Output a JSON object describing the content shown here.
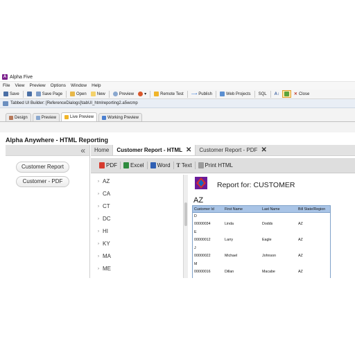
{
  "window": {
    "title": "Alpha Five",
    "icon": "alpha-five-app-icon"
  },
  "menu": [
    "File",
    "View",
    "Preview",
    "Options",
    "Window",
    "Help"
  ],
  "toolbar": {
    "save": "Save",
    "save_page": "Save Page",
    "open": "Open",
    "new": "New",
    "preview": "Preview",
    "remote_test": "Remote Test",
    "publish": "Publish",
    "web_projects": "Web Projects",
    "sql": "SQL",
    "close": "Close"
  },
  "document": {
    "title": "Tabbed UI Builder: [ReferenceDialogs]\\tabUI_htmlreporting2.a5wcmp"
  },
  "mode_tabs": [
    "Design",
    "Preview",
    "Live Preview",
    "Working Preview"
  ],
  "page": {
    "title": "Alpha Anywhere - HTML Reporting",
    "collapse_glyph": "«"
  },
  "left_nav": [
    "Customer Report",
    "Customer - PDF"
  ],
  "tabs": [
    {
      "label": "Home"
    },
    {
      "label": "Customer Report - HTML"
    },
    {
      "label": "Customer Report - PDF"
    }
  ],
  "close_glyph": "✕",
  "report_toolbar": {
    "pdf": "PDF",
    "excel": "Excel",
    "word": "Word",
    "text": "Text",
    "print_html": "Print HTML"
  },
  "states": [
    "AZ",
    "CA",
    "CT",
    "DC",
    "HI",
    "KY",
    "MA",
    "ME"
  ],
  "state_arrow": "›",
  "report": {
    "title": "Report for: CUSTOMER",
    "group": "AZ",
    "columns": [
      "Customer Id",
      "First Name",
      "Last Name",
      "Bill State/Region"
    ],
    "rows": [
      {
        "break": "D"
      },
      {
        "id": "00000034",
        "first": "Linda",
        "last": "Dodds",
        "state": "AZ"
      },
      {
        "break": "E"
      },
      {
        "id": "00000012",
        "first": "Larry",
        "last": "Eagle",
        "state": "AZ"
      },
      {
        "break": "J"
      },
      {
        "id": "00000022",
        "first": "Michael",
        "last": "Johnson",
        "state": "AZ"
      },
      {
        "break": "M"
      },
      {
        "id": "00000016",
        "first": "Dillan",
        "last": "Macabe",
        "state": "AZ"
      }
    ]
  },
  "colors": {
    "table_header": "#a9c4e6",
    "table_border": "#7ea1c9",
    "brand": "#7a1f8b"
  }
}
